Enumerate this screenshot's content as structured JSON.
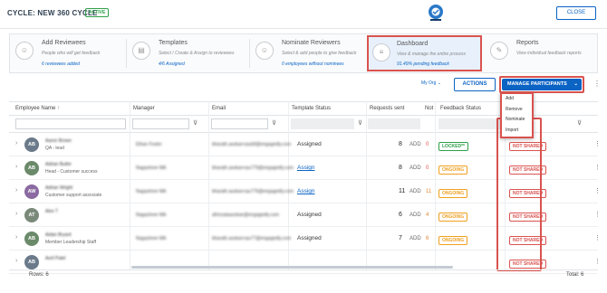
{
  "header": {
    "title": "CYCLE: NEW 360 CYCLE",
    "badge": "ACTIVE",
    "close_label": "CLOSE"
  },
  "steps": [
    {
      "title": "Add Reviewees",
      "subtitle": "People who will get feedback",
      "meta": "6 reviewees added"
    },
    {
      "title": "Templates",
      "subtitle": "Select / Create & Assign to reviewees",
      "meta": "4/6 Assigned"
    },
    {
      "title": "Nominate Reviewers",
      "subtitle": "Select & add people to give feedback",
      "meta": "0 employees without nominees"
    },
    {
      "title": "Dashboard",
      "subtitle": "View & manage the entire process",
      "meta": "91.49% pending feedback"
    },
    {
      "title": "Reports",
      "subtitle": "View individual feedback reports",
      "meta": ""
    }
  ],
  "toolbar": {
    "filter": "My Org",
    "actions_label": "ACTIONS",
    "manage_label": "MANAGE PARTICIPANTS"
  },
  "menu": [
    "Add",
    "Remove",
    "Nominate",
    "Import"
  ],
  "columns": {
    "employee": "Employee Name",
    "manager": "Manager",
    "email": "Email",
    "template": "Template Status",
    "requests": "Requests sent",
    "not": "Not",
    "feedback": "Feedback Status"
  },
  "add_label": "ADD",
  "rows": [
    {
      "initials": "AB",
      "name": "Aaron Brown",
      "role": "QA - lead",
      "manager": "Ethan Foster",
      "email": "bharath.asokan+pub9@engagedly.com",
      "template": "Assigned",
      "requests": "8",
      "not": "0",
      "feedback": "LOCKED**",
      "share": "NOT SHARED"
    },
    {
      "initials": "AB",
      "name": "Adrian Butler",
      "role": "Head - Customer success",
      "manager": "Nagashree MA",
      "email": "bharath.asokan+pu779@engagedly.com",
      "template": "Assign",
      "requests": "8",
      "not": "0",
      "feedback": "ONGOING",
      "share": "NOT SHARED"
    },
    {
      "initials": "AW",
      "name": "Adrian Wright",
      "role": "Customer support associate",
      "manager": "Nagashree MA",
      "email": "bharath.asokan+pu776@engagedly.com",
      "template": "Assign",
      "requests": "11",
      "not": "11",
      "feedback": "ONGOING",
      "share": "NOT SHARED"
    },
    {
      "initials": "AT",
      "name": "Alex T",
      "role": "",
      "manager": "Nagashree MA",
      "email": "afrinzataasokan@engagedly.com",
      "template": "Assigned",
      "requests": "6",
      "not": "4",
      "feedback": "ONGOING",
      "share": "NOT SHARED"
    },
    {
      "initials": "AB",
      "name": "Aidan Bryant",
      "role": "Member Leadership Staff",
      "manager": "Nagashree MA",
      "email": "bharath.asokan+pu77@engagedly.com",
      "template": "Assigned",
      "requests": "7",
      "not": "6",
      "feedback": "ONGOING",
      "share": "NOT SHARED"
    },
    {
      "initials": "AB",
      "name": "Avril Patel",
      "role": "",
      "manager": "",
      "email": "",
      "template": "",
      "requests": "",
      "not": "",
      "feedback": "",
      "share": "NOT SHARED"
    }
  ],
  "footer": {
    "rows": "Rows: 6",
    "total": "Total: 6"
  },
  "colors": {
    "accent": "#0b63c4",
    "highlight": "#d9534f",
    "active": "#2fa04a",
    "ongoing": "#f0a020"
  }
}
